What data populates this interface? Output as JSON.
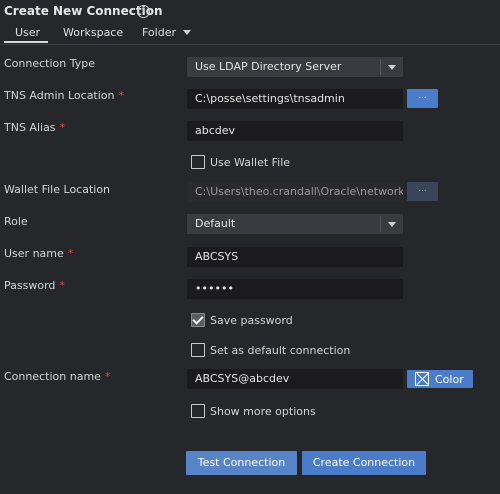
{
  "header": {
    "title": "Create New Connection",
    "info_icon": "info-icon"
  },
  "tabs": [
    {
      "label": "User",
      "active": true
    },
    {
      "label": "Workspace",
      "active": false
    },
    {
      "label": "Folder",
      "active": false
    }
  ],
  "form": {
    "connection_type": {
      "label": "Connection Type",
      "value": "Use LDAP Directory Server"
    },
    "tns_admin_location": {
      "label": "TNS Admin Location",
      "required": "*",
      "value": "C:\\posse\\settings\\tnsadmin",
      "browse_label": "..."
    },
    "tns_alias": {
      "label": "TNS Alias",
      "required": "*",
      "value": "abcdev"
    },
    "use_wallet_file": {
      "label": "Use Wallet File",
      "checked": false
    },
    "wallet_file_location": {
      "label": "Wallet File Location",
      "value": "C:\\Users\\theo.crandall\\Oracle\\network\\adm",
      "browse_label": "..."
    },
    "role": {
      "label": "Role",
      "value": "Default"
    },
    "user_name": {
      "label": "User name",
      "required": "*",
      "value": "ABCSYS"
    },
    "password": {
      "label": "Password",
      "required": "*",
      "value": "••••••"
    },
    "save_password": {
      "label": "Save password",
      "checked": true
    },
    "default_connection": {
      "label": "Set as default connection",
      "checked": false
    },
    "connection_name": {
      "label": "Connection name",
      "required": "*",
      "value": "ABCSYS@abcdev",
      "color_label": "Color"
    },
    "show_more_options": {
      "label": "Show more options",
      "checked": false
    }
  },
  "buttons": {
    "test": "Test Connection",
    "create": "Create Connection"
  },
  "colors": {
    "background": "#26272b",
    "input_bg": "#1b1b1e",
    "accent": "#4a7cc9",
    "required": "#e0484f"
  }
}
